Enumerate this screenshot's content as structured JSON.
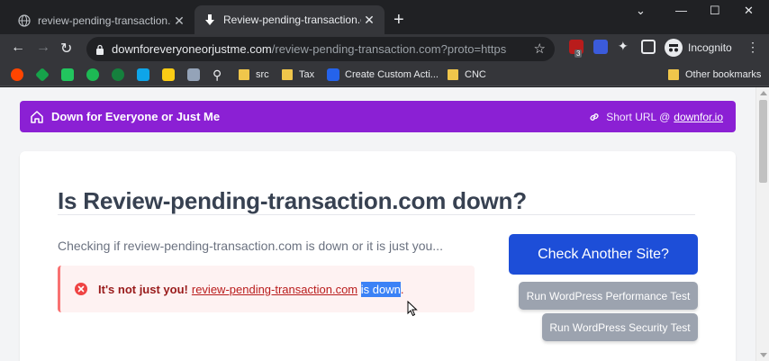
{
  "browser": {
    "tabs": [
      {
        "title": "review-pending-transaction.com",
        "active": false
      },
      {
        "title": "Review-pending-transaction.com",
        "active": true
      }
    ],
    "address": {
      "host": "downforeveryoneorjustme.com",
      "path": "/review-pending-transaction.com?proto=https"
    },
    "profile_label": "Incognito",
    "extension_badge": "3",
    "bookmarks": [
      "src",
      "Tax",
      "Create Custom Acti...",
      "CNC"
    ],
    "other_bookmarks": "Other bookmarks"
  },
  "page": {
    "brand": "Down for Everyone or Just Me",
    "short_url_prefix": "Short URL @",
    "short_url_link": "downfor.io",
    "heading": "Is Review-pending-transaction.com down?",
    "checking_text": "Checking if review-pending-transaction.com is down or it is just you...",
    "alert": {
      "bold": "It's not just you!",
      "site": "review-pending-transaction.com",
      "selected": "is down",
      "tail": "."
    },
    "buttons": {
      "check_another": "Check Another Site?",
      "wp_perf": "Run WordPress Performance Test",
      "wp_security": "Run WordPress Security Test"
    }
  },
  "colors": {
    "brand_purple": "#8b20d4",
    "primary_blue": "#1d4ed8",
    "alert_red": "#b91c1c"
  }
}
